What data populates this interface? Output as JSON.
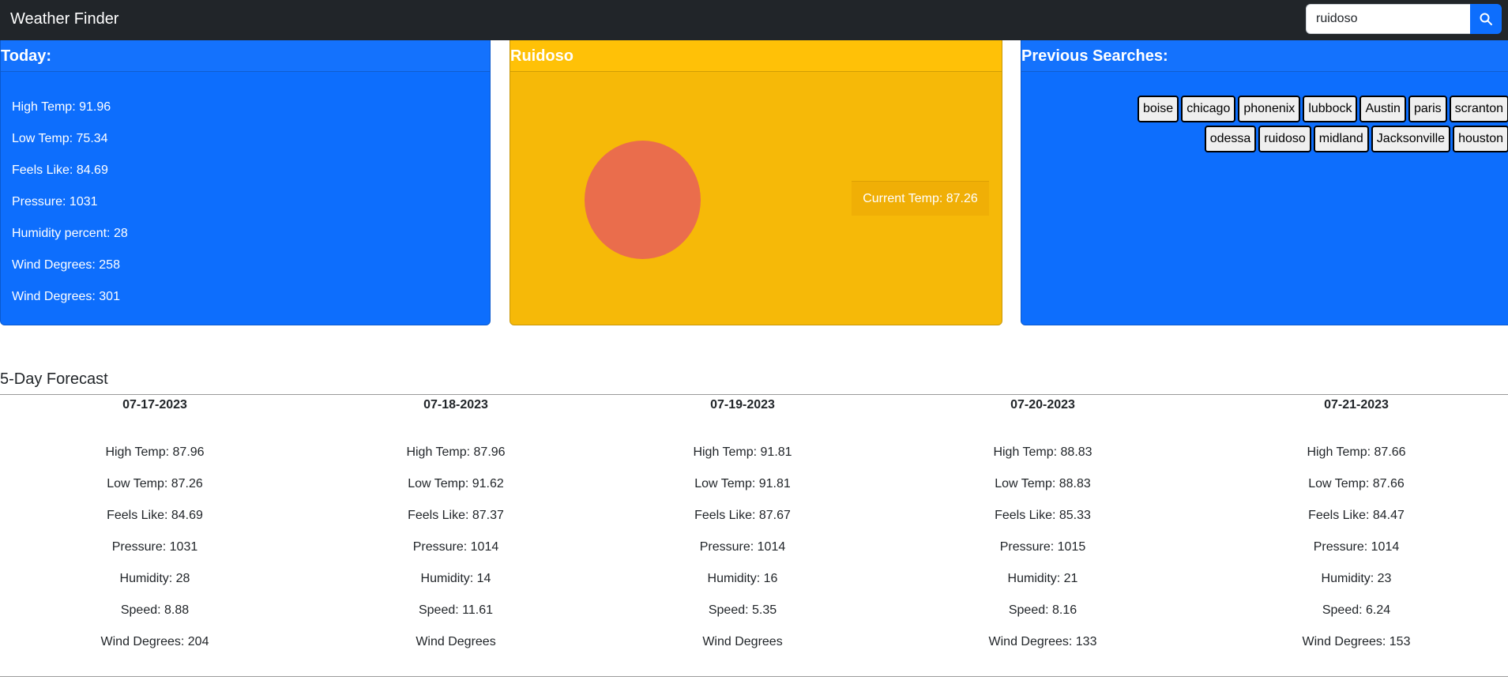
{
  "navbar": {
    "brand": "Weather Finder"
  },
  "search": {
    "value": "ruidoso",
    "button_icon": "search-icon"
  },
  "today": {
    "title": "Today:",
    "items": [
      "High Temp: 91.96",
      "Low Temp: 75.34",
      "Feels Like: 84.69",
      "Pressure: 1031",
      "Humidity percent: 28",
      "Wind Degrees: 258",
      "Wind Degrees: 301"
    ]
  },
  "city": {
    "name": "Ruidoso",
    "current_temp": "Current Temp: 87.26",
    "sun_color": "#ea6d4c"
  },
  "history": {
    "title": "Previous Searches:",
    "items": [
      "boise",
      "chicago",
      "phonenix",
      "lubbock",
      "Austin",
      "paris",
      "scranton",
      "odessa",
      "ruidoso",
      "midland",
      "Jacksonville",
      "houston"
    ]
  },
  "forecast": {
    "title": "5-Day Forecast",
    "days": [
      {
        "date": "07-17-2023",
        "items": [
          "High Temp: 87.96",
          "Low Temp: 87.26",
          "Feels Like: 84.69",
          "Pressure: 1031",
          "Humidity: 28",
          "Speed: 8.88",
          "Wind Degrees: 204"
        ]
      },
      {
        "date": "07-18-2023",
        "items": [
          "High Temp: 87.96",
          "Low Temp: 91.62",
          "Feels Like: 87.37",
          "Pressure: 1014",
          "Humidity: 14",
          "Speed: 11.61",
          "Wind Degrees"
        ]
      },
      {
        "date": "07-19-2023",
        "items": [
          "High Temp: 91.81",
          "Low Temp: 91.81",
          "Feels Like: 87.67",
          "Pressure: 1014",
          "Humidity: 16",
          "Speed: 5.35",
          "Wind Degrees"
        ]
      },
      {
        "date": "07-20-2023",
        "items": [
          "High Temp: 88.83",
          "Low Temp: 88.83",
          "Feels Like: 85.33",
          "Pressure: 1015",
          "Humidity: 21",
          "Speed: 8.16",
          "Wind Degrees: 133"
        ]
      },
      {
        "date": "07-21-2023",
        "items": [
          "High Temp: 87.66",
          "Low Temp: 87.66",
          "Feels Like: 84.47",
          "Pressure: 1014",
          "Humidity: 23",
          "Speed: 6.24",
          "Wind Degrees: 153"
        ]
      }
    ]
  },
  "colors": {
    "primary": "#0d6efd",
    "warning": "#ffc107",
    "navbar": "#212529"
  }
}
